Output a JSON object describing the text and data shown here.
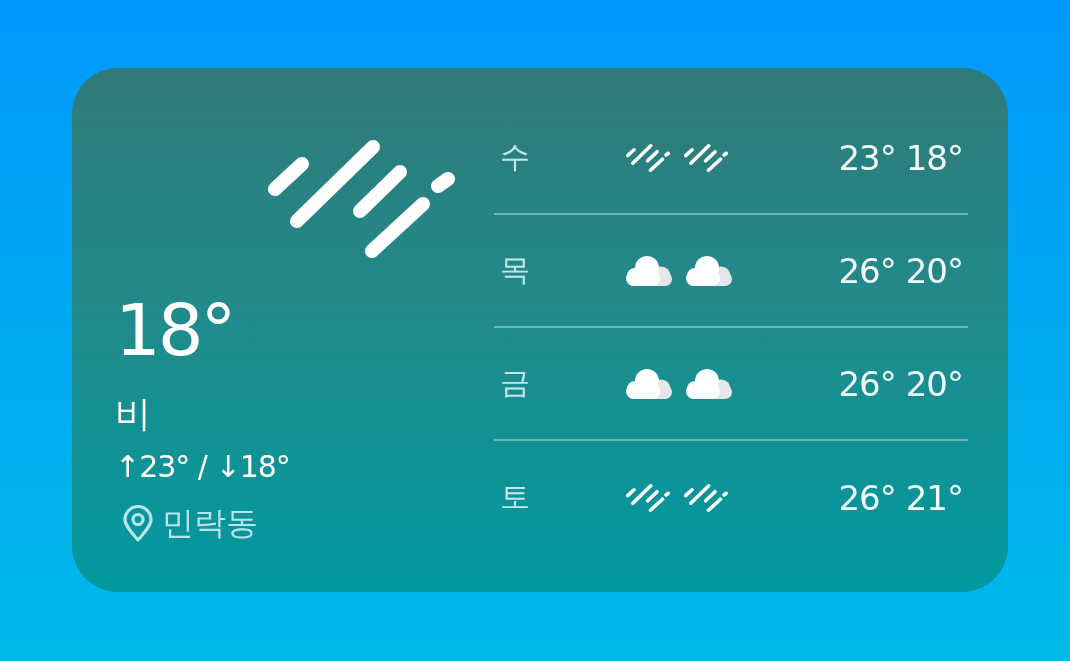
{
  "current": {
    "kind": "rain",
    "temperature": "18°",
    "condition": "비",
    "high_low": "↑23° / ↓18°",
    "location": "민락동"
  },
  "forecast": [
    {
      "day": "수",
      "icons": [
        {
          "kind": "rain"
        },
        {
          "kind": "rain"
        }
      ],
      "high": "23°",
      "low": "18°"
    },
    {
      "day": "목",
      "icons": [
        {
          "kind": "cloud"
        },
        {
          "kind": "cloud"
        }
      ],
      "high": "26°",
      "low": "20°"
    },
    {
      "day": "금",
      "icons": [
        {
          "kind": "cloud"
        },
        {
          "kind": "cloud"
        }
      ],
      "high": "26°",
      "low": "20°"
    },
    {
      "day": "토",
      "icons": [
        {
          "kind": "rain"
        },
        {
          "kind": "rain"
        }
      ],
      "high": "26°",
      "low": "21°"
    }
  ]
}
